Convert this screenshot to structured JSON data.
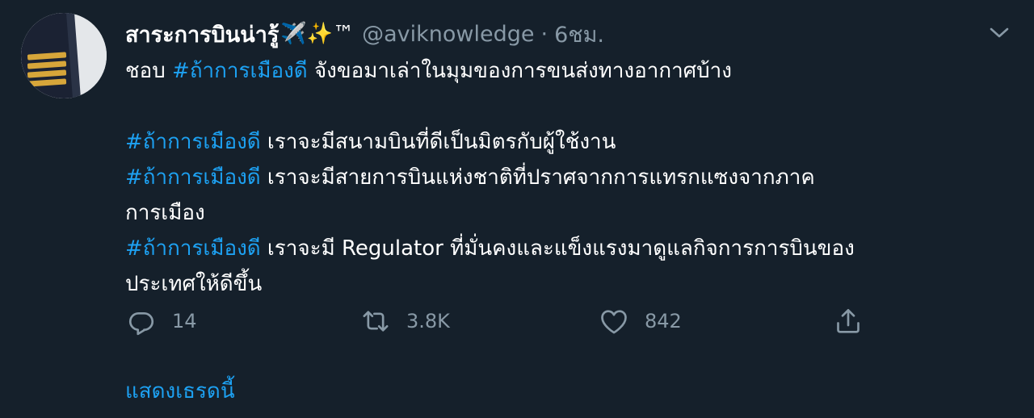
{
  "tweet": {
    "display_name": "สาระการบินน่ารู้",
    "name_emoji": "✈️✨™",
    "handle": "@aviknowledge",
    "separator": "·",
    "time": "6ชม.",
    "hashtag": "#ถ้าการเมืองดี",
    "lines": [
      {
        "before": "ชอบ ",
        "tag": "#ถ้าการเมืองดี",
        "after": " จังขอมาเล่าในมุมของการขนส่งทางอากาศบ้าง"
      },
      {
        "before": "",
        "tag": "",
        "after": ""
      },
      {
        "before": "",
        "tag": "#ถ้าการเมืองดี",
        "after": " เราจะมีสนามบินที่ดีเป็นมิตรกับผู้ใช้งาน"
      },
      {
        "before": "",
        "tag": "#ถ้าการเมืองดี",
        "after": " เราจะมีสายการบินแห่งชาติที่ปราศจากการแทรกแซงจากภาค"
      },
      {
        "before": "",
        "tag": "",
        "after": "การเมือง"
      },
      {
        "before": "",
        "tag": "#ถ้าการเมืองดี",
        "after": " เราจะมี Regulator ที่มั่นคงและแข็งแรงมาดูแลกิจการการบินของ"
      },
      {
        "before": "",
        "tag": "",
        "after": "ประเทศให้ดีขึ้น"
      }
    ],
    "actions": {
      "reply_count": "14",
      "retweet_count": "3.8K",
      "like_count": "842"
    },
    "show_thread": "แสดงเธรดนี้"
  },
  "colors": {
    "background": "#15202b",
    "text": "#ffffff",
    "secondary": "#8899a6",
    "accent": "#1da1f2"
  },
  "icons": [
    "avatar-pilot-epaulette",
    "chevron-down-icon",
    "reply-icon",
    "retweet-icon",
    "like-icon",
    "share-icon"
  ]
}
